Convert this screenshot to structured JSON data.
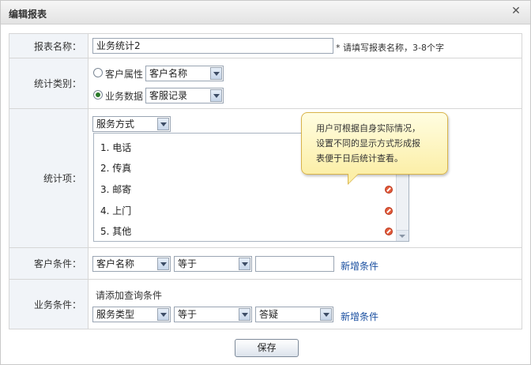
{
  "dialog": {
    "title": "编辑报表",
    "close_label": "✕"
  },
  "form": {
    "report_name": {
      "label": "报表名称：",
      "value": "业务统计2",
      "hint": "* 请填写报表名称，3-8个字"
    },
    "stat_category": {
      "label": "统计类别：",
      "options": [
        {
          "radio_label": "客户属性",
          "select_value": "客户名称",
          "checked": false
        },
        {
          "radio_label": "业务数据",
          "select_value": "客服记录",
          "checked": true
        }
      ]
    },
    "stat_items": {
      "label": "统计项：",
      "select_value": "服务方式",
      "items": [
        "1. 电话",
        "2. 传真",
        "3. 邮寄",
        "4. 上门",
        "5. 其他"
      ]
    },
    "customer_condition": {
      "label": "客户条件：",
      "field": "客户名称",
      "operator": "等于",
      "value": "",
      "add_link": "新增条件"
    },
    "business_condition": {
      "label": "业务条件：",
      "prompt": "请添加查询条件",
      "field": "服务类型",
      "operator": "等于",
      "value": "答疑",
      "add_link": "新增条件"
    }
  },
  "tooltip": {
    "lines": [
      "用户可根据自身实际情况，",
      "设置不同的显示方式形成报",
      "表便于日后统计查看。"
    ]
  },
  "save_label": "保存"
}
